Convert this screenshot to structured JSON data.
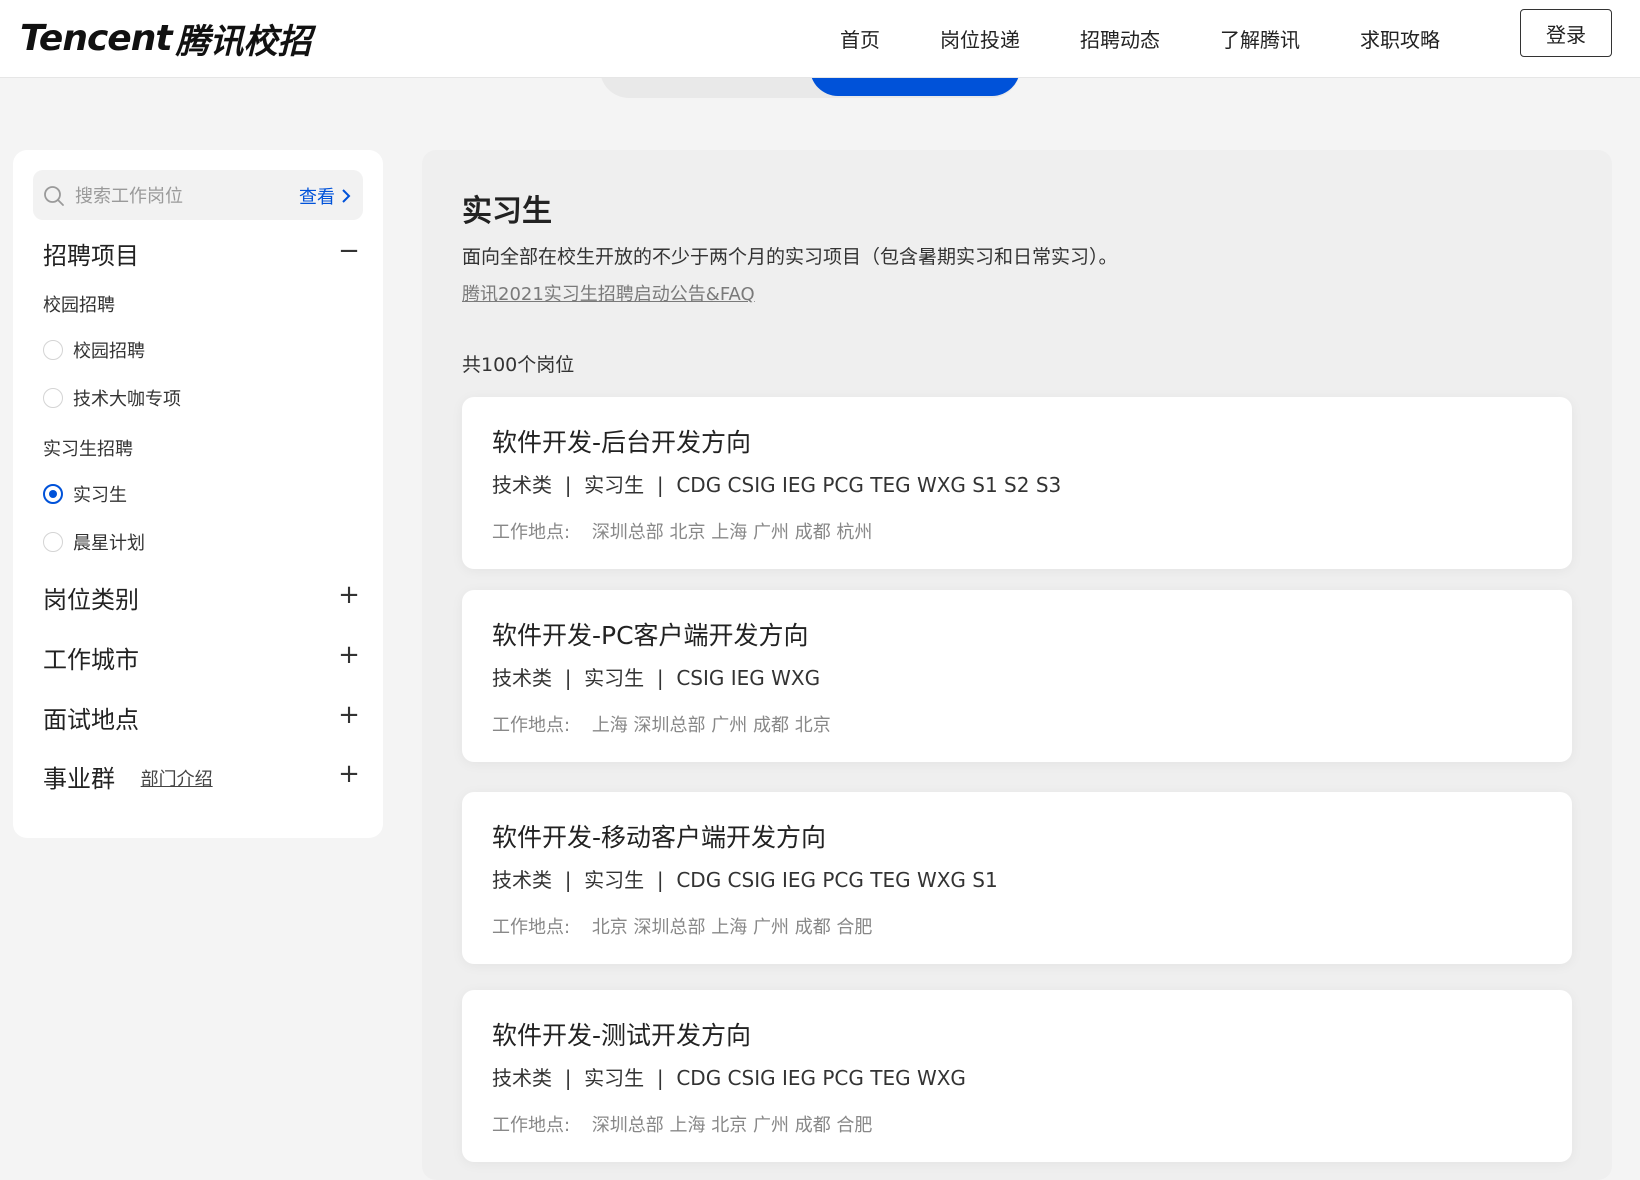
{
  "header": {
    "logo_en": "Tencent",
    "logo_cn": "腾讯校招",
    "nav": [
      "首页",
      "岗位投递",
      "招聘动态",
      "了解腾讯",
      "求职攻略"
    ],
    "login_label": "登录"
  },
  "sidebar": {
    "search": {
      "placeholder": "搜索工作岗位",
      "value": "",
      "view_label": "查看"
    },
    "recruit_project": {
      "title": "招聘项目",
      "campus_group": "校园招聘",
      "campus_options": [
        "校园招聘",
        "技术大咖专项"
      ],
      "intern_group": "实习生招聘",
      "intern_options": [
        "实习生",
        "晨星计划"
      ],
      "selected": "实习生"
    },
    "filters": {
      "job_category": "岗位类别",
      "work_city": "工作城市",
      "interview_location": "面试地点",
      "business_group": "事业群",
      "dept_intro_link": "部门介绍"
    }
  },
  "main": {
    "title": "实习生",
    "description": "面向全部在校生开放的不少于两个月的实习项目（包含暑期实习和日常实习）。",
    "announce_link": "腾讯2021实习生招聘启动公告&FAQ",
    "count_text": "共100个岗位",
    "location_label": "工作地点:",
    "jobs": [
      {
        "title": "软件开发-后台开发方向",
        "tags": "技术类  |  实习生  |  CDG CSIG IEG PCG TEG WXG S1 S2 S3",
        "locations": "深圳总部 北京 上海 广州 成都 杭州"
      },
      {
        "title": "软件开发-PC客户端开发方向",
        "tags": "技术类  |  实习生  |  CSIG IEG WXG",
        "locations": "上海 深圳总部 广州 成都 北京"
      },
      {
        "title": "软件开发-移动客户端开发方向",
        "tags": "技术类  |  实习生  |  CDG CSIG IEG PCG TEG WXG S1",
        "locations": "北京 深圳总部 上海 广州 成都 合肥"
      },
      {
        "title": "软件开发-测试开发方向",
        "tags": "技术类  |  实习生  |  CDG CSIG IEG PCG TEG WXG",
        "locations": "深圳总部 上海 北京 广州 成都 合肥"
      }
    ]
  },
  "colors": {
    "accent": "#0052d9",
    "page_bg": "#f4f4f4"
  }
}
